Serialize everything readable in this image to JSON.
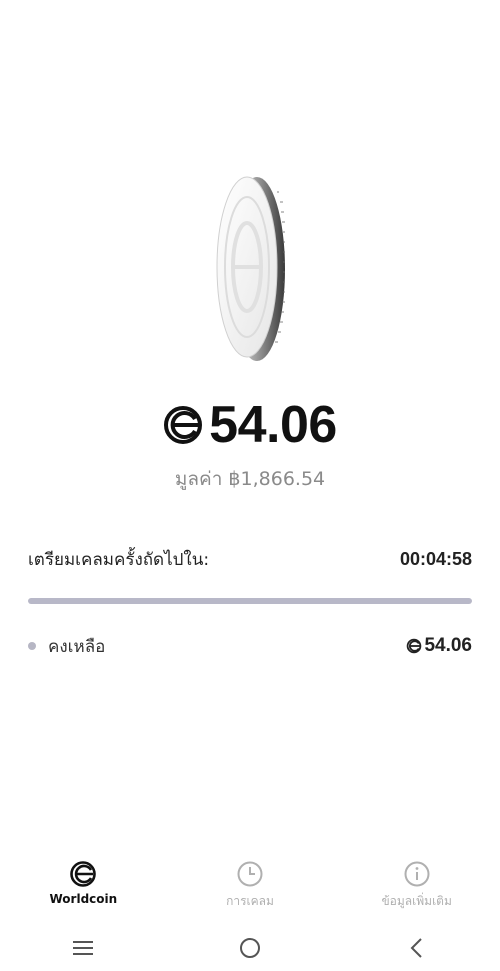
{
  "balance": {
    "amount": "54.06",
    "fiat_value": "มูลค่า ฿1,866.54"
  },
  "next_claim": {
    "label": "เตรียมเคลมครั้งถัดไปใน:",
    "timer": "00:04:58",
    "progress_fraction": 1.0
  },
  "remaining": {
    "label": "คงเหลือ",
    "value": "54.06"
  },
  "tabs": [
    {
      "label": "Worldcoin",
      "icon": "worldcoin-icon",
      "active": true
    },
    {
      "label": "การเคลม",
      "icon": "clock-icon",
      "active": false
    },
    {
      "label": "ข้อมูลเพิ่มเติม",
      "icon": "info-icon",
      "active": false
    }
  ],
  "system_nav": [
    "menu-icon",
    "home-icon",
    "back-icon"
  ],
  "colors": {
    "progress_fill": "#b8b8c8",
    "progress_track": "#dcdce2",
    "accent": "#111111",
    "muted": "#8a8a8a"
  }
}
